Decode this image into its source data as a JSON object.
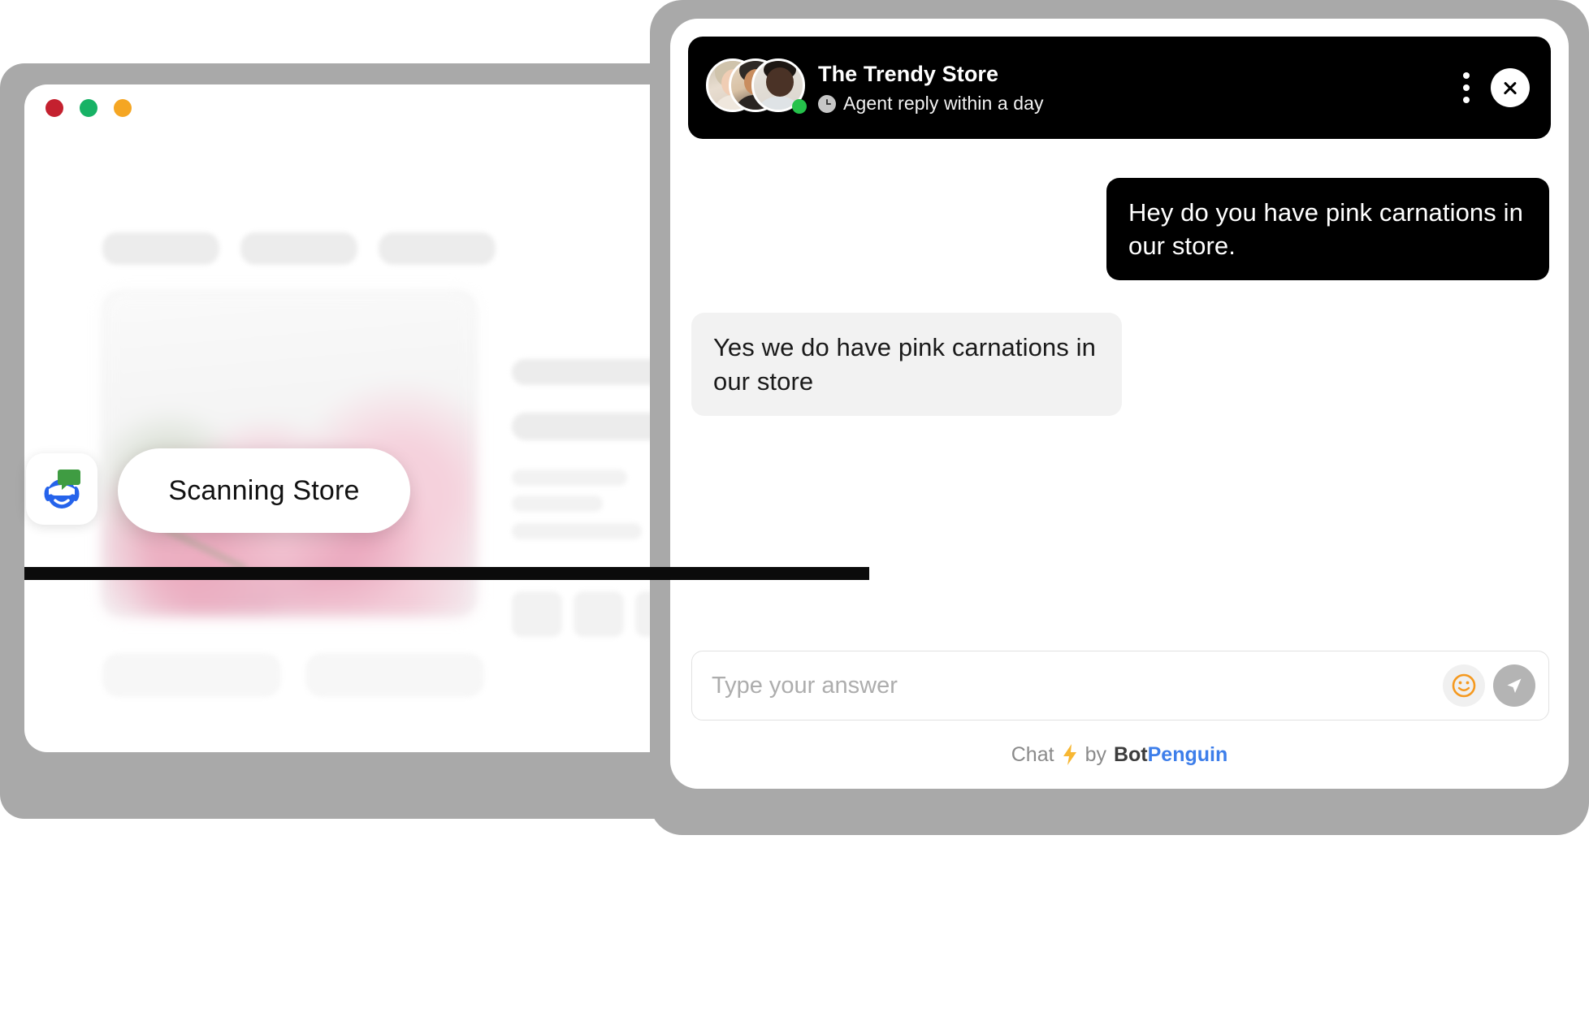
{
  "browser_window": {
    "traffic_lights": [
      {
        "name": "close",
        "color": "#c4212f"
      },
      {
        "name": "minimize",
        "color": "#17b265"
      },
      {
        "name": "maximize",
        "color": "#f5a623"
      }
    ],
    "scan_status_label": "Scanning Store",
    "bot_logo_name": "botpenguin-logo-icon",
    "skeleton_placeholder_count": 16
  },
  "chat_widget": {
    "header": {
      "title": "The Trendy Store",
      "status_text": "Agent reply within a day",
      "clock_icon": "clock-icon",
      "online_indicator_color": "#25c24b",
      "menu_icon": "kebab-menu-icon",
      "close_icon": "close-icon",
      "background_color": "#000000",
      "avatars": [
        {
          "name": "agent-avatar-1"
        },
        {
          "name": "agent-avatar-2"
        },
        {
          "name": "agent-avatar-3"
        }
      ]
    },
    "messages": [
      {
        "direction": "outgoing",
        "text": "Hey do you have pink carnations in our store.",
        "background_color": "#000000",
        "text_color": "#ffffff"
      },
      {
        "direction": "incoming",
        "text": "Yes we do have pink carnations in our store",
        "background_color": "#f2f2f2",
        "text_color": "#1a1a1a"
      }
    ],
    "composer": {
      "placeholder": "Type your answer",
      "value": "",
      "emoji_icon": "emoji-smiley-icon",
      "emoji_color": "#f5991f",
      "send_icon": "send-arrow-icon",
      "send_button_color": "#b4b4b4"
    },
    "footer": {
      "chat_label": "Chat",
      "bolt_icon": "lightning-bolt-icon",
      "by_label": "by",
      "brand_first": "Bot",
      "brand_second": "Penguin",
      "brand_accent_color": "#3d7eea"
    }
  }
}
